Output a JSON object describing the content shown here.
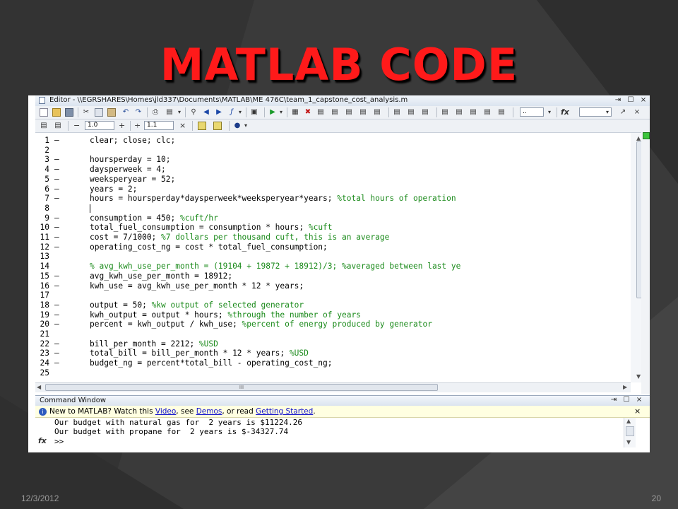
{
  "slide": {
    "title": "MATLAB CODE",
    "date": "12/3/2012",
    "page_number": "20"
  },
  "editor": {
    "title": "Editor - \\\\EGRSHARES\\Homes\\jld337\\Documents\\MATLAB\\ME 476C\\team_1_capstone_cost_analysis.m",
    "cell_step_minus": "−",
    "cell_value_1": "1.0",
    "cell_step_plus": "+",
    "cell_divide": "÷",
    "cell_value_2": "1.1",
    "cell_close": "×",
    "stack_value": "..",
    "fx_label": "fx",
    "lines": [
      {
        "num": "1",
        "dash": "–",
        "code": "clear; close; clc;",
        "comment": ""
      },
      {
        "num": "2",
        "dash": "",
        "code": "",
        "comment": ""
      },
      {
        "num": "3",
        "dash": "–",
        "code": "hoursperday = 10;",
        "comment": ""
      },
      {
        "num": "4",
        "dash": "–",
        "code": "daysperweek = 4;",
        "comment": ""
      },
      {
        "num": "5",
        "dash": "–",
        "code": "weeksperyear = 52;",
        "comment": ""
      },
      {
        "num": "6",
        "dash": "–",
        "code": "years = 2;",
        "comment": ""
      },
      {
        "num": "7",
        "dash": "–",
        "code": "hours = hoursperday*daysperweek*weeksperyear*years; ",
        "comment": "%total hours of operation"
      },
      {
        "num": "8",
        "dash": "",
        "code": "",
        "comment": ""
      },
      {
        "num": "9",
        "dash": "–",
        "code": "consumption = 450; ",
        "comment": "%cuft/hr"
      },
      {
        "num": "10",
        "dash": "–",
        "code": "total_fuel_consumption = consumption * hours; ",
        "comment": "%cuft"
      },
      {
        "num": "11",
        "dash": "–",
        "code": "cost = 7/1000; ",
        "comment": "%7 dollars per thousand cuft, this is an average"
      },
      {
        "num": "12",
        "dash": "–",
        "code": "operating_cost_ng = cost * total_fuel_consumption;",
        "comment": ""
      },
      {
        "num": "13",
        "dash": "",
        "code": "",
        "comment": ""
      },
      {
        "num": "14",
        "dash": "",
        "code": "",
        "comment": "% avg_kwh_use_per_month = (19104 + 19872 + 18912)/3; %averaged between last ye"
      },
      {
        "num": "15",
        "dash": "–",
        "code": "avg_kwh_use_per_month = 18912;",
        "comment": ""
      },
      {
        "num": "16",
        "dash": "–",
        "code": "kwh_use = avg_kwh_use_per_month * 12 * years;",
        "comment": ""
      },
      {
        "num": "17",
        "dash": "",
        "code": "",
        "comment": ""
      },
      {
        "num": "18",
        "dash": "–",
        "code": "output = 50; ",
        "comment": "%kw output of selected generator"
      },
      {
        "num": "19",
        "dash": "–",
        "code": "kwh_output = output * hours; ",
        "comment": "%through the number of years"
      },
      {
        "num": "20",
        "dash": "–",
        "code": "percent = kwh_output / kwh_use; ",
        "comment": "%percent of energy produced by generator"
      },
      {
        "num": "21",
        "dash": "",
        "code": "",
        "comment": ""
      },
      {
        "num": "22",
        "dash": "–",
        "code": "bill_per_month = 2212; ",
        "comment": "%USD"
      },
      {
        "num": "23",
        "dash": "–",
        "code": "total_bill = bill_per_month * 12 * years; ",
        "comment": "%USD"
      },
      {
        "num": "24",
        "dash": "–",
        "code": "budget_ng = percent*total_bill - operating_cost_ng;",
        "comment": ""
      },
      {
        "num": "25",
        "dash": "",
        "code": "",
        "comment": ""
      }
    ]
  },
  "command_window": {
    "title": "Command Window",
    "info_prefix": "New to MATLAB? Watch this ",
    "link_video": "Video",
    "info_sep1": ", see ",
    "link_demos": "Demos",
    "info_sep2": ", or read ",
    "link_getting_started": "Getting Started",
    "info_suffix": ".",
    "output_lines": [
      "Our budget with natural gas for  2 years is $11224.26",
      "Our budget with propane for  2 years is $-34327.74"
    ],
    "prompt": ">>",
    "fx_label": "fx"
  }
}
